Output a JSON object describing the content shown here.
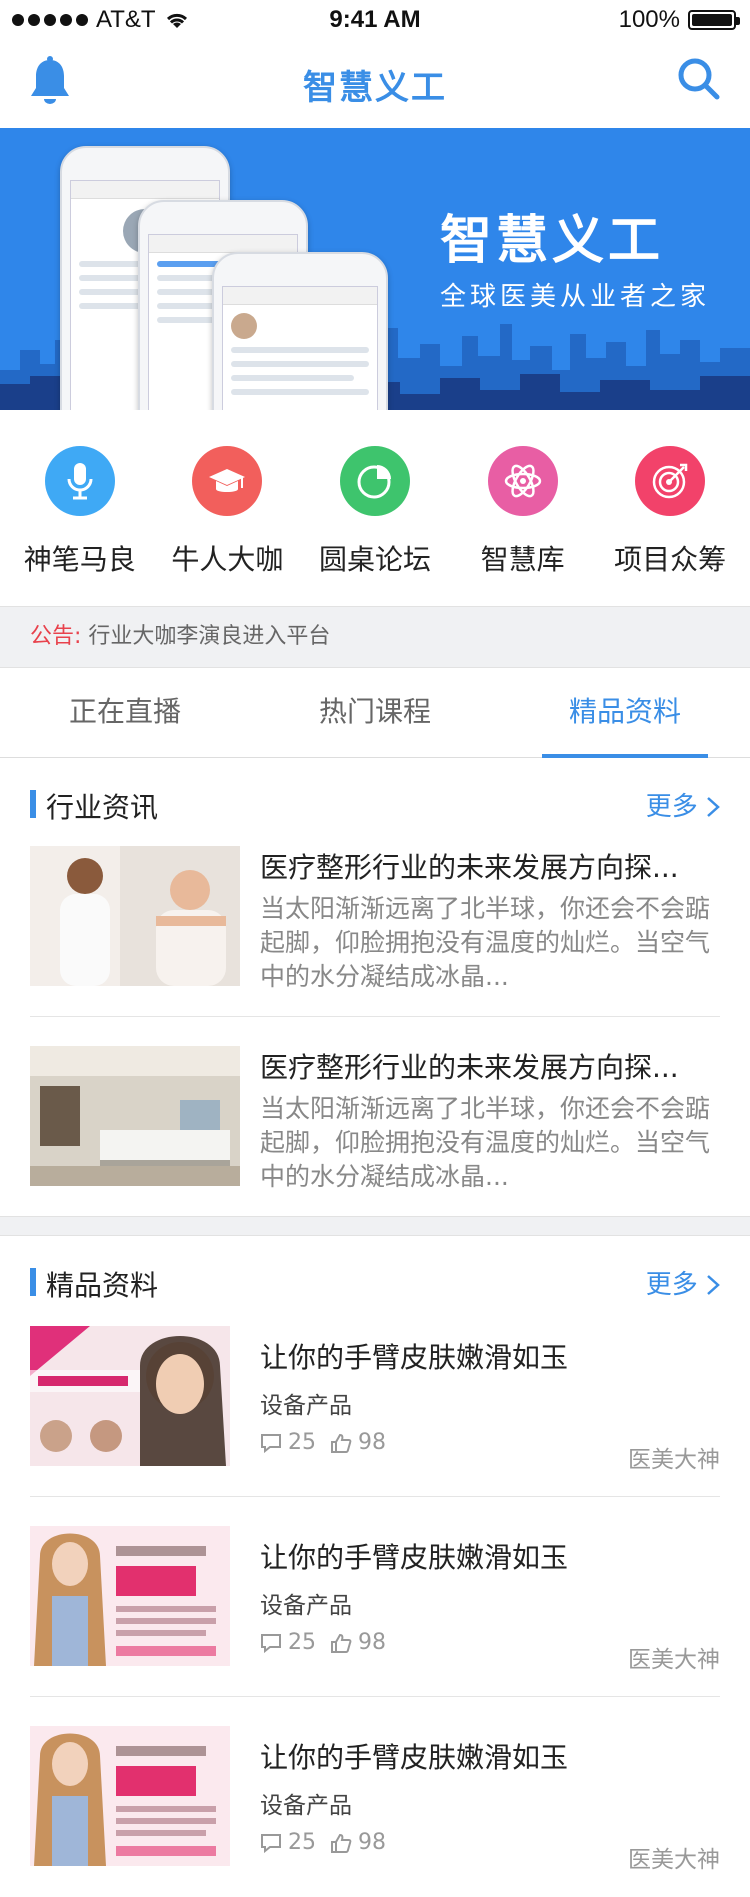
{
  "status_bar": {
    "carrier": "AT&T",
    "time": "9:41 AM",
    "battery": "100%"
  },
  "nav": {
    "title": "智慧义工",
    "left_icon": "bell-icon",
    "right_icon": "search-icon",
    "accent": "#3a8ee6"
  },
  "banner": {
    "title": "智慧义工",
    "subtitle": "全球医美从业者之家"
  },
  "categories": [
    {
      "label": "神笔马良",
      "icon": "microphone-icon",
      "color": "#3fa9f5"
    },
    {
      "label": "牛人大咖",
      "icon": "graduation-cap-icon",
      "color": "#f25f5c"
    },
    {
      "label": "圆桌论坛",
      "icon": "pie-chart-icon",
      "color": "#3ec46d"
    },
    {
      "label": "智慧库",
      "icon": "atom-icon",
      "color": "#e85ea4"
    },
    {
      "label": "项目众筹",
      "icon": "target-icon",
      "color": "#f2426a"
    }
  ],
  "notice": {
    "tag": "公告:",
    "text": "行业大咖李演良进入平台"
  },
  "tabs": [
    {
      "label": "正在直播"
    },
    {
      "label": "热门课程"
    },
    {
      "label": "精品资料"
    }
  ],
  "industry": {
    "title": "行业资讯",
    "more": "更多",
    "items": [
      {
        "title": "医疗整形行业的未来发展方向探...",
        "desc": "当太阳渐渐远离了北半球，你还会不会踮起脚，仰脸拥抱没有温度的灿烂。当空气中的水分凝结成冰晶..."
      },
      {
        "title": "医疗整形行业的未来发展方向探...",
        "desc": "当太阳渐渐远离了北半球，你还会不会踮起脚，仰脸拥抱没有温度的灿烂。当空气中的水分凝结成冰晶..."
      }
    ]
  },
  "resources": {
    "title": "精品资料",
    "more": "更多",
    "items": [
      {
        "title": "让你的手臂皮肤嫩滑如玉",
        "category": "设备产品",
        "comments": "25",
        "likes": "98",
        "author": "医美大神"
      },
      {
        "title": "让你的手臂皮肤嫩滑如玉",
        "category": "设备产品",
        "comments": "25",
        "likes": "98",
        "author": "医美大神"
      },
      {
        "title": "让你的手臂皮肤嫩滑如玉",
        "category": "设备产品",
        "comments": "25",
        "likes": "98",
        "author": "医美大神"
      }
    ]
  }
}
